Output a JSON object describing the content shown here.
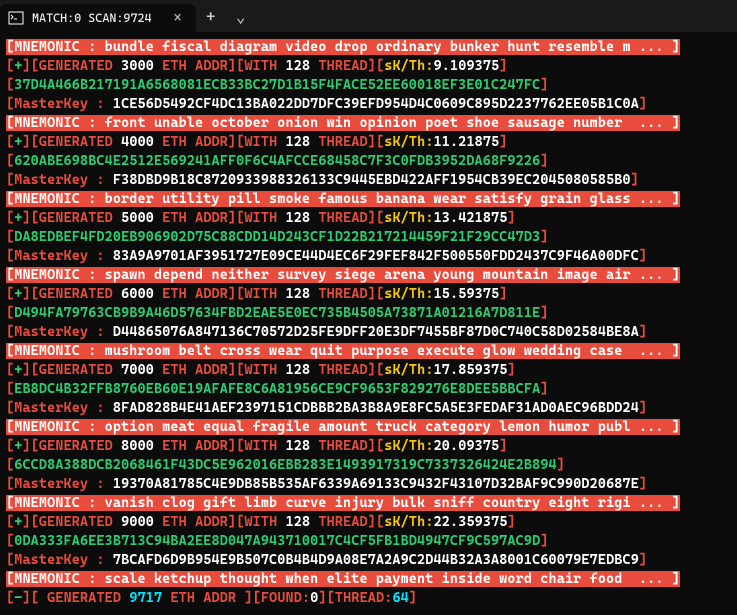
{
  "window": {
    "tab_title": "MATCH:0 SCAN:9724",
    "close": "×",
    "newtab": "+",
    "dropdown": "⌄"
  },
  "entries": [
    {
      "mnemonic": "bundle fiscal diagram video drop ordinary bunker hunt resemble m ...",
      "gen_count": "3000",
      "thread": "128",
      "skth": "9.109375",
      "derived": "37D4A466B217191A6568081ECB33BC27D1B15F4FACE52EE60018EF3E01C247FC",
      "masterkey": "1CE56D5492CF4DC13BA022DD7DFC39EFD954D4C0609C895D2237762EE05B1C0A"
    },
    {
      "mnemonic": "front unable october onion win opinion poet shoe sausage number  ...",
      "gen_count": "4000",
      "thread": "128",
      "skth": "11.21875",
      "derived": "620ABE698BC4E2512E569241AFF0F6C4AFCCE68458C7F3C0FDB3952DA68F9226",
      "masterkey": "F38DBD9B18C8720933988326133C9445EBD422AFF1954CB39EC2045080585B0"
    },
    {
      "mnemonic": "border utility pill smoke famous banana wear satisfy grain glass ...",
      "gen_count": "5000",
      "thread": "128",
      "skth": "13.421875",
      "derived": "DA8EDBEF4FD20EB906902D75C88CDD14D243CF1D22B217214459F21F29CC47D3",
      "masterkey": "83A9A9701AF3951727E09CE44D4EC6F29FEF842F500550FDD2437C9F46A00DFC"
    },
    {
      "mnemonic": "spawn depend neither survey siege arena young mountain image air ...",
      "gen_count": "6000",
      "thread": "128",
      "skth": "15.59375",
      "derived": "D494FA79763CB9B9A46D57634FBD2EAE5E0EC735B4505A73871A01216A7D811E",
      "masterkey": "D44865076A847136C70572D25FE9DFF20E3DF7455BF87D0C740C58D02584BE8A"
    },
    {
      "mnemonic": "mushroom belt cross wear quit purpose execute glow wedding case  ...",
      "gen_count": "7000",
      "thread": "128",
      "skth": "17.859375",
      "derived": "EB8DC4B32FFB8760EB60E19AFAFE8C6A81956CE9CF9653F829276E8DEE5BBCFA",
      "masterkey": "8FAD828B4E41AEF2397151CDBBB2BA3B8A9E8FC5A5E3FEDAF31AD0AEC96BDD24"
    },
    {
      "mnemonic": "option meat equal fragile amount truck category lemon humor publ ...",
      "gen_count": "8000",
      "thread": "128",
      "skth": "20.09375",
      "derived": "6CCD8A388DCB2068461F43DC5E962016EBB283E1493917319C7337326424E2B894",
      "masterkey": "19370A81785C4E9DB85B535AF6339A69133C9432F43107D32BAF9C990D20687E"
    },
    {
      "mnemonic": "vanish clog gift limb curve injury bulk sniff country eight rigi ...",
      "gen_count": "9000",
      "thread": "128",
      "skth": "22.359375",
      "derived": "0DA333FA6EE3B713C94BA2EE8D047A943710017C4CF5FB1BD4947CF9C597AC9D",
      "masterkey": "7BCAFD6D9B954E9B507C0B4B4D9A08E7A2A9C2D44B32A3A8001C60079E7EDBC9"
    }
  ],
  "last_mnemonic": "scale ketchup thought when elite payment inside word chair food  ...",
  "labels": {
    "mnemonic_prefix": "[MNEMONIC : ",
    "mnemonic_suffix": " ]",
    "gen_open": "[",
    "plus": "+",
    "minus": "-",
    "gen_mid": "][",
    "gen_label": "GENERATED ",
    "eth_addr": " ETH ADDR",
    "with": "WITH ",
    "thread_suffix": " THREAD",
    "skth": "sK/Th:",
    "masterkey_label": "MasterKey : ",
    "found_label": "FOUND:",
    "thread_label": "THREAD:",
    "close_br": "]"
  },
  "summary": {
    "generated": "9717",
    "found": "0",
    "thread": "64"
  }
}
